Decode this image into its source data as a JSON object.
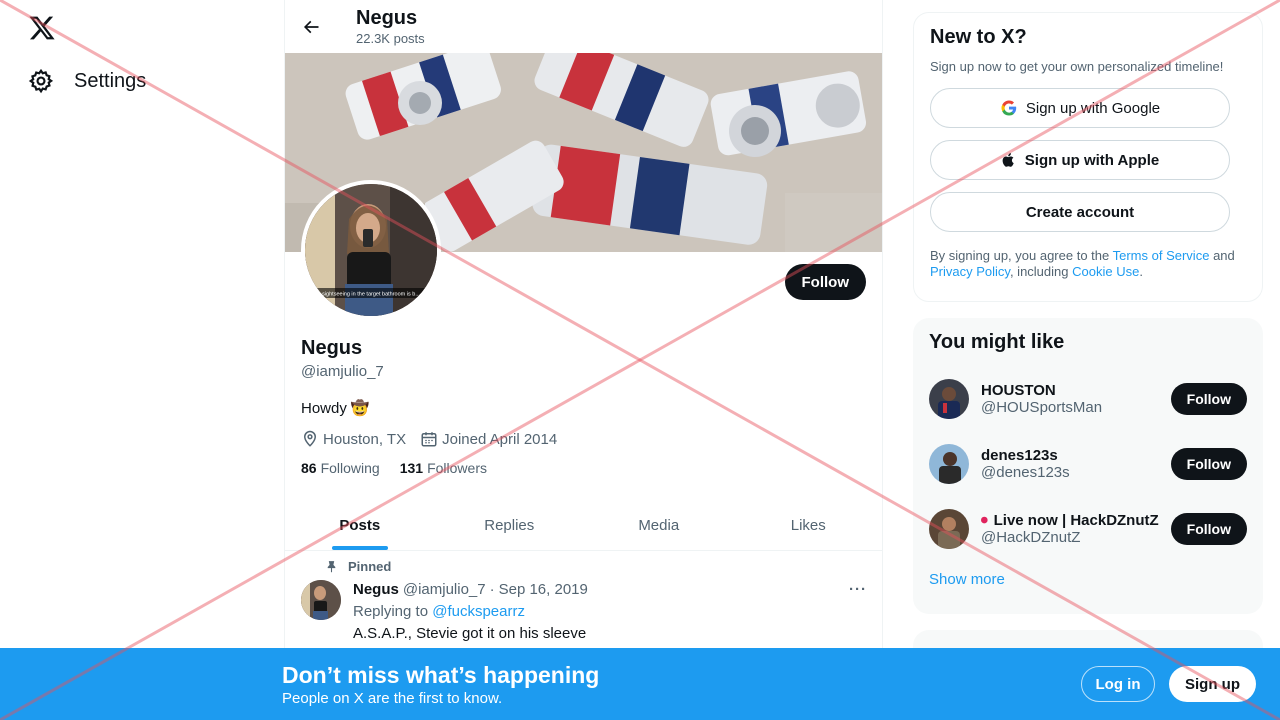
{
  "nav": {
    "settings_label": "Settings"
  },
  "header": {
    "title": "Negus",
    "post_count": "22.3K posts"
  },
  "profile": {
    "follow_label": "Follow",
    "name": "Negus",
    "handle": "@iamjulio_7",
    "bio": "Howdy",
    "bio_emoji": "🤠",
    "location": "Houston, TX",
    "joined": "Joined April 2014",
    "following_count": "86",
    "following_label": "Following",
    "followers_count": "131",
    "followers_label": "Followers",
    "avatar_caption": "sightseeing in the target bathroom is b..."
  },
  "tabs": [
    {
      "label": "Posts",
      "active": true
    },
    {
      "label": "Replies",
      "active": false
    },
    {
      "label": "Media",
      "active": false
    },
    {
      "label": "Likes",
      "active": false
    }
  ],
  "tweet": {
    "pinned_label": "Pinned",
    "author": "Negus",
    "handle": "@iamjulio_7",
    "separator": "·",
    "date": "Sep 16, 2019",
    "more": "···",
    "replying_label": "Replying to",
    "replying_to": "@fuckspearrz",
    "text": "A.S.A.P., Stevie got it on his sleeve"
  },
  "signup_card": {
    "title": "New to X?",
    "subtitle": "Sign up now to get your own personalized timeline!",
    "google_label": "Sign up with Google",
    "apple_label": "Sign up with Apple",
    "create_label": "Create account",
    "terms_prefix": "By signing up, you agree to the",
    "terms_link": "Terms of Service",
    "and": "and",
    "privacy_link": "Privacy Policy",
    "including": ", including",
    "cookie_link": "Cookie Use",
    "period": "."
  },
  "suggestions": {
    "title": "You might like",
    "users": [
      {
        "name": "HOUSTON",
        "handle": "@HOUSportsMan",
        "follow_label": "Follow",
        "live": false
      },
      {
        "name": "denes123s",
        "handle": "@denes123s",
        "follow_label": "Follow",
        "live": false
      },
      {
        "name": "Live now | HackDZnutZ",
        "handle": "@HackDZnutZ",
        "follow_label": "Follow",
        "live": true
      }
    ],
    "show_more": "Show more"
  },
  "bottom_bar": {
    "title": "Don’t miss what’s happening",
    "subtitle": "People on X are the first to know.",
    "login_label": "Log in",
    "signup_label": "Sign up"
  },
  "colors": {
    "accent": "#1d9bf0",
    "text_primary": "#0f1419",
    "text_secondary": "#536471",
    "overlay_cross": "#e8505b"
  }
}
